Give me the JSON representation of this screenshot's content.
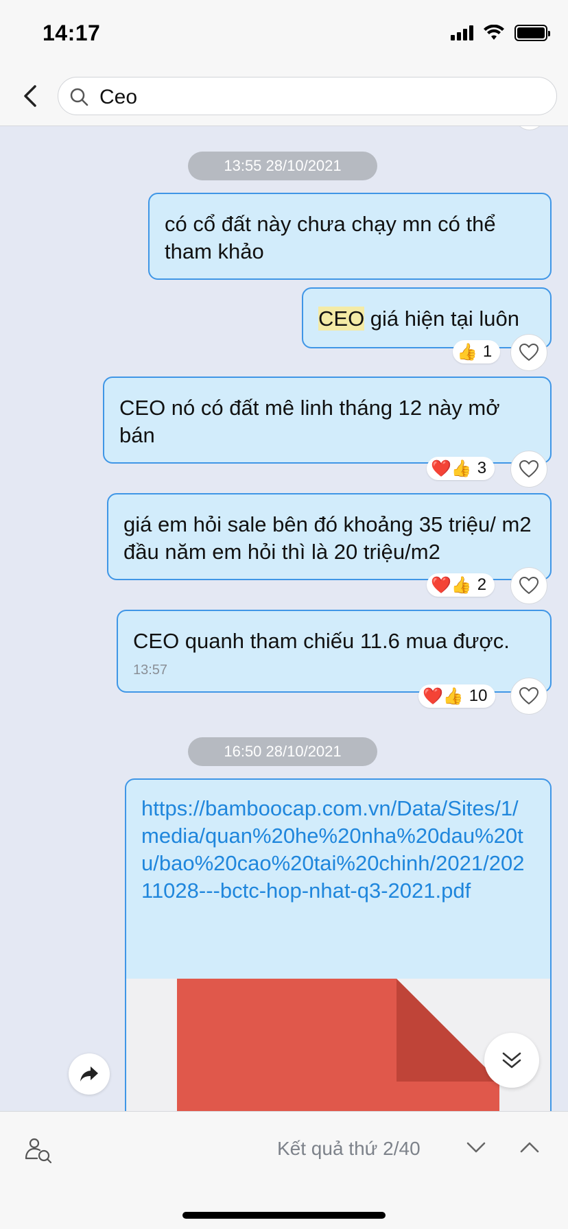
{
  "status_bar": {
    "time": "14:17"
  },
  "search": {
    "query": "Ceo"
  },
  "messages": [
    {
      "date": "13:55 28/10/2021"
    },
    {
      "text": "có cổ đất này chưa chạy mn có thể tham khảo"
    },
    {
      "highlight": "CEO",
      "text_after": " giá hiện tại luôn",
      "reactions": "👍",
      "count": "1"
    },
    {
      "text": "CEO nó có đất mê linh tháng 12 này mở bán",
      "reactions": "❤️👍",
      "count": "3"
    },
    {
      "text": "giá em hỏi sale bên đó khoảng 35 triệu/ m2 đầu năm em hỏi thì là 20 triệu/m2",
      "reactions": "❤️👍",
      "count": "2"
    },
    {
      "text": "CEO quanh tham chiếu 11.6 mua được.",
      "time": "13:57",
      "reactions": "❤️👍",
      "count": "10"
    },
    {
      "date": "16:50 28/10/2021"
    },
    {
      "link": "https://bamboocap.com.vn/Data/Sites/1/media/quan%20he%20nha%20dau%20tu/bao%20cao%20tai%20chinh/2021/20211028---bctc-hop-nhat-q3-2021.pdf"
    }
  ],
  "bottom_bar": {
    "result_text": "Kết quả thứ 2/40"
  },
  "icons": {
    "back": "chevron-left-icon",
    "search": "search-icon",
    "heart": "heart-outline-icon",
    "share": "share-arrow-icon",
    "scroll_down": "double-chevron-down-icon",
    "find_user": "user-search-icon",
    "down": "chevron-down-icon",
    "up": "chevron-up-icon"
  },
  "colors": {
    "bubble_bg": "#d2ecfb",
    "bubble_border": "#3f96e6",
    "link": "#1f86dc",
    "chat_bg": "#e4e8f3",
    "highlight": "#f4eba6"
  }
}
